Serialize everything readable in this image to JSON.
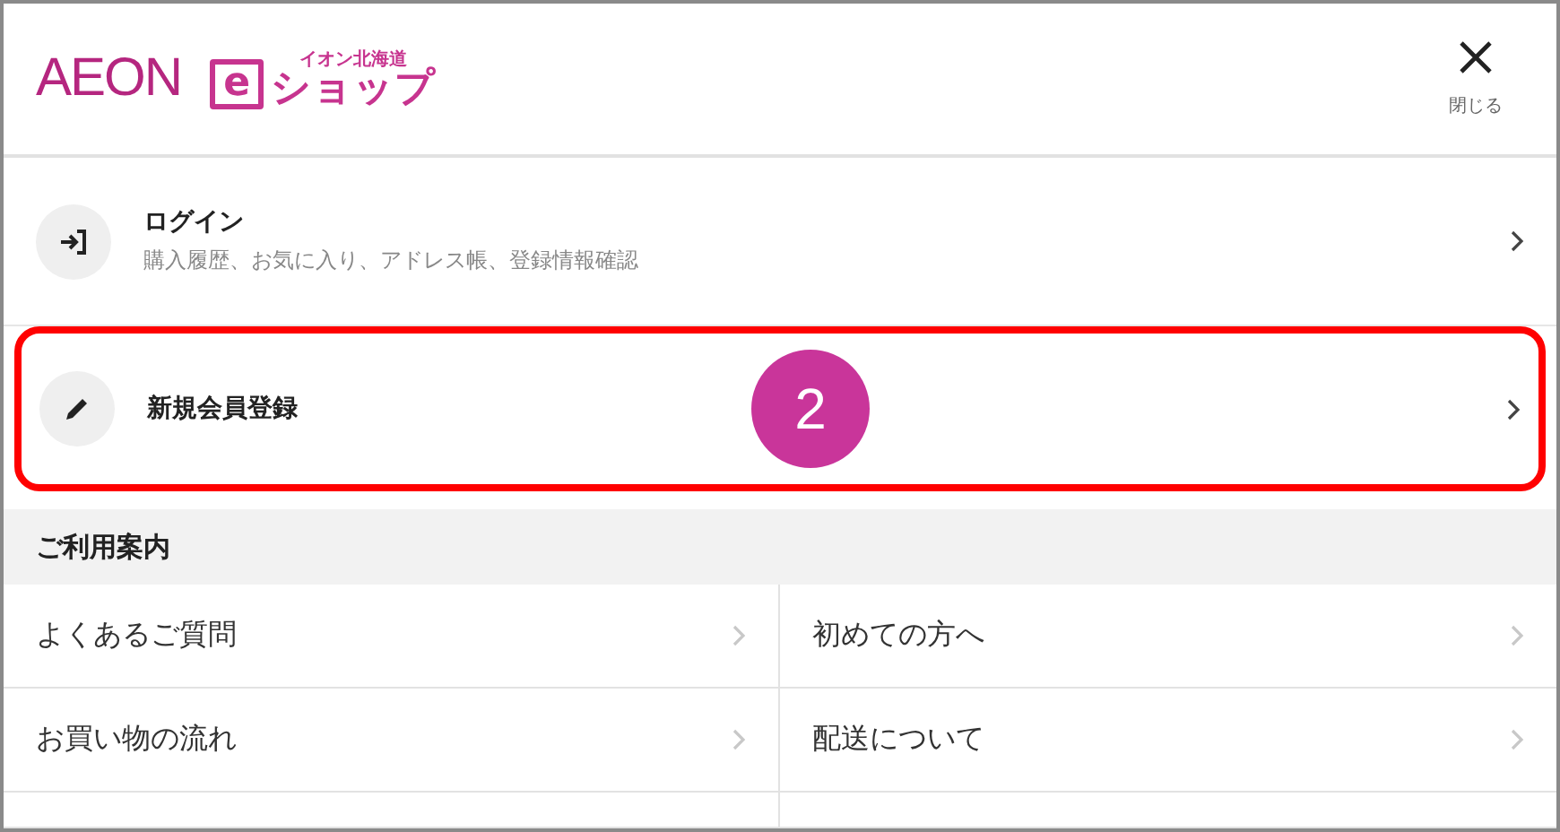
{
  "header": {
    "logo": {
      "brand": "AEON",
      "e": "e",
      "sub": "イオン北海道",
      "shop": "ショップ"
    },
    "close_label": "閉じる"
  },
  "menu": [
    {
      "kind": "login",
      "title": "ログイン",
      "subtitle": "購入履歴、お気に入り、アドレス帳、登録情報確認",
      "highlighted": false
    },
    {
      "kind": "register",
      "title": "新規会員登録",
      "highlighted": true,
      "badge": "2"
    }
  ],
  "guide": {
    "heading": "ご利用案内",
    "links": [
      "よくあるご質問",
      "初めての方へ",
      "お買い物の流れ",
      "配送について"
    ]
  }
}
